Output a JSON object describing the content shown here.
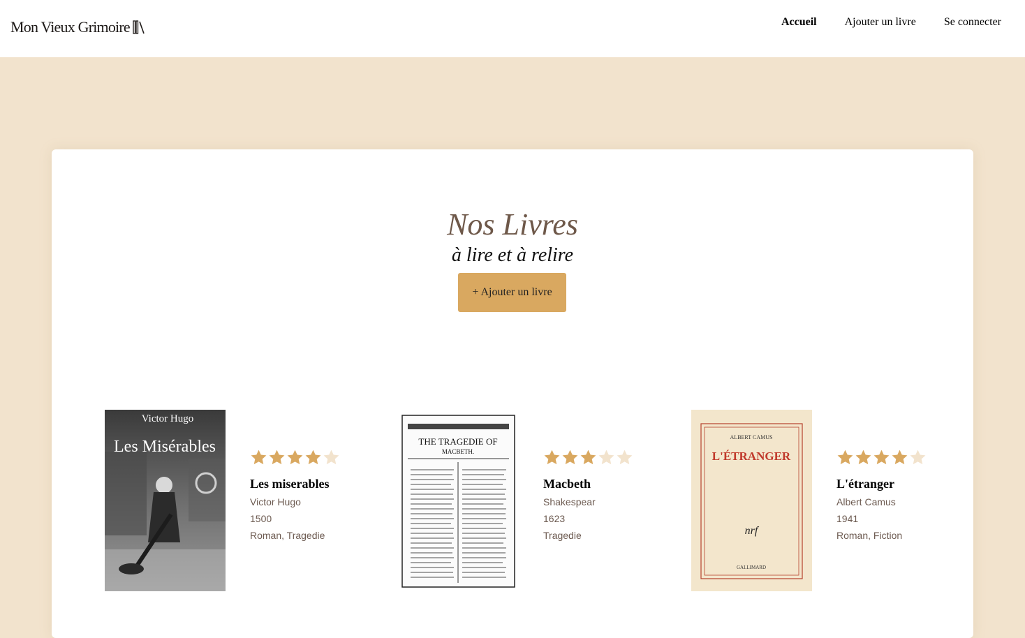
{
  "header": {
    "logo_text": "Mon Vieux Grimoire",
    "logo_icon": "books-icon",
    "nav": [
      {
        "label": "Accueil",
        "active": true
      },
      {
        "label": "Ajouter un livre",
        "active": false
      },
      {
        "label": "Se connecter",
        "active": false
      }
    ]
  },
  "main": {
    "title": "Nos Livres",
    "subtitle": "à lire et à relire",
    "add_button": "+ Ajouter un livre"
  },
  "books": [
    {
      "title": "Les miserables",
      "author": "Victor Hugo",
      "year": "1500",
      "genre": "Roman, Tragedie",
      "rating": 4,
      "cover_text": {
        "author": "Victor Hugo",
        "title": "Les Misérables"
      }
    },
    {
      "title": "Macbeth",
      "author": "Shakespear",
      "year": "1623",
      "genre": "Tragedie",
      "rating": 3,
      "cover_text": {
        "title": "THE TRAGEDIE OF",
        "subtitle": "MACBETH."
      }
    },
    {
      "title": "L'étranger",
      "author": "Albert Camus",
      "year": "1941",
      "genre": "Roman, Fiction",
      "rating": 4,
      "cover_text": {
        "author": "ALBERT CAMUS",
        "title": "L'ÉTRANGER",
        "mark": "nrf",
        "publisher": "GALLIMARD"
      }
    }
  ],
  "colors": {
    "background": "#f2e3cd",
    "accent": "#d9a860",
    "star_filled": "#d9a860",
    "star_empty": "#f2e3cd",
    "title": "#6e5849"
  }
}
